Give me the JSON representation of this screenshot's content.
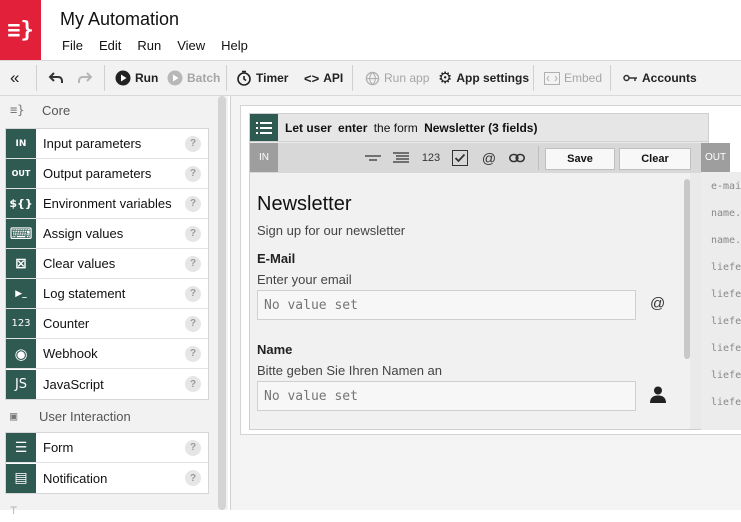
{
  "app": {
    "title": "My Automation",
    "logo_text": "≡}",
    "accent": "#e3203a",
    "node_color": "#2f5a52"
  },
  "menu": [
    "File",
    "Edit",
    "Run",
    "View",
    "Help"
  ],
  "toolbar": {
    "collapse_icon": "«",
    "run": "Run",
    "batch": "Batch",
    "timer": "Timer",
    "api": "API",
    "run_app": "Run app",
    "app_settings": "App settings",
    "embed": "Embed",
    "accounts": "Accounts"
  },
  "sidebar": {
    "core_label": "Core",
    "core_items": [
      {
        "label": "Input parameters",
        "icon": "IN",
        "icon_name": "input-icon"
      },
      {
        "label": "Output parameters",
        "icon": "OUT",
        "icon_name": "output-icon"
      },
      {
        "label": "Environment variables",
        "icon": "${}",
        "icon_name": "env-icon"
      },
      {
        "label": "Assign values",
        "icon": "⌨",
        "icon_name": "keyboard-icon"
      },
      {
        "label": "Clear values",
        "icon": "⊠",
        "icon_name": "clear-icon"
      },
      {
        "label": "Log statement",
        "icon": "▶_",
        "icon_name": "terminal-icon"
      },
      {
        "label": "Counter",
        "icon": "123",
        "icon_name": "counter-icon"
      },
      {
        "label": "Webhook",
        "icon": "◉",
        "icon_name": "globe-icon"
      },
      {
        "label": "JavaScript",
        "icon": "JS",
        "icon_name": "js-icon"
      }
    ],
    "ui_label": "User Interaction",
    "ui_items": [
      {
        "label": "Form",
        "icon": "☰",
        "icon_name": "form-icon"
      },
      {
        "label": "Notification",
        "icon": "▤",
        "icon_name": "notification-icon"
      }
    ],
    "help": "?"
  },
  "node": {
    "prefix": "Let user",
    "verb": "enter",
    "mid": "the form",
    "form_name": "Newsletter (3 fields)",
    "in_label": "IN",
    "out_label": "OUT",
    "save": "Save",
    "clear": "Clear",
    "tools": {
      "number": "123",
      "at": "@"
    }
  },
  "form": {
    "title": "Newsletter",
    "subtitle": "Sign up for our newsletter",
    "fields": [
      {
        "label": "E-Mail",
        "hint": "Enter your email",
        "placeholder": "No value set",
        "icon": "@"
      },
      {
        "label": "Name",
        "hint": "Bitte geben Sie Ihren Namen an",
        "placeholder": "No value set",
        "icon": "person"
      }
    ]
  },
  "out_rows": [
    "e-mai",
    "name.",
    "name.",
    "liefe",
    "liefe",
    "liefe",
    "liefe",
    "liefe",
    "liefe"
  ]
}
